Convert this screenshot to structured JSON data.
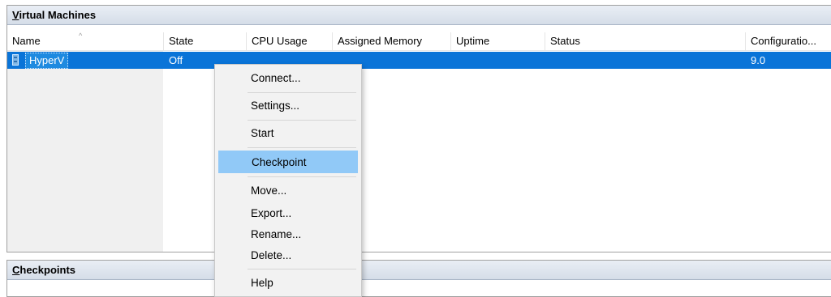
{
  "vm_pane": {
    "title_prefix": "",
    "title_mnemonic": "V",
    "title_rest": "irtual Machines",
    "columns": [
      "Name",
      "State",
      "CPU Usage",
      "Assigned Memory",
      "Uptime",
      "Status",
      "Configuratio..."
    ],
    "rows": [
      {
        "name": "HyperV",
        "state": "Off",
        "cpu": "",
        "memory": "",
        "uptime": "",
        "status": "",
        "config": "9.0"
      }
    ]
  },
  "checkpoints_pane": {
    "title_mnemonic": "C",
    "title_rest": "heckpoints"
  },
  "context_menu": {
    "items": [
      "Connect...",
      "Settings...",
      "Start",
      "Checkpoint",
      "Move...",
      "Export...",
      "Rename...",
      "Delete...",
      "Help"
    ],
    "highlighted": "Checkpoint"
  },
  "colors": {
    "selection": "#0a74d8",
    "menu_highlight": "#91c9f7",
    "pane_header": "#dbe3ee"
  }
}
